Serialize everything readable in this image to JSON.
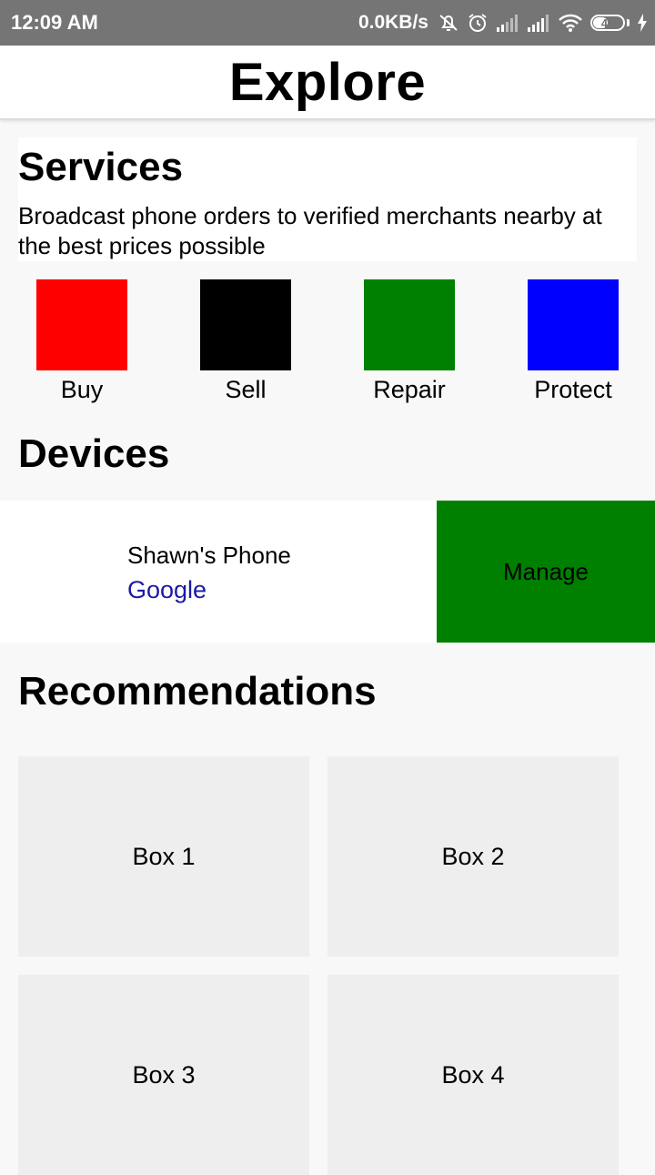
{
  "status_bar": {
    "time": "12:09 AM",
    "speed": "0.0KB/s",
    "battery": "46",
    "battery_level": 0.46,
    "icons": [
      "mute-icon",
      "alarm-icon",
      "signal-icon",
      "signal-icon",
      "wifi-icon",
      "battery-icon",
      "charging-icon"
    ]
  },
  "header": {
    "title": "Explore"
  },
  "services": {
    "title": "Services",
    "description": "Broadcast phone orders to verified merchants nearby at the best prices possible",
    "items": [
      {
        "label": "Buy",
        "color": "#ff0000"
      },
      {
        "label": "Sell",
        "color": "#000000"
      },
      {
        "label": "Repair",
        "color": "#008000"
      },
      {
        "label": "Protect",
        "color": "#0000ff"
      }
    ]
  },
  "devices": {
    "title": "Devices",
    "items": [
      {
        "name": "Shawn's Phone",
        "brand": "Google",
        "action": "Manage",
        "action_color": "#008000",
        "brand_color": "#1a1aa6"
      }
    ]
  },
  "recommendations": {
    "title": "Recommendations",
    "boxes": [
      "Box 1",
      "Box 2",
      "Box 3",
      "Box 4"
    ]
  }
}
